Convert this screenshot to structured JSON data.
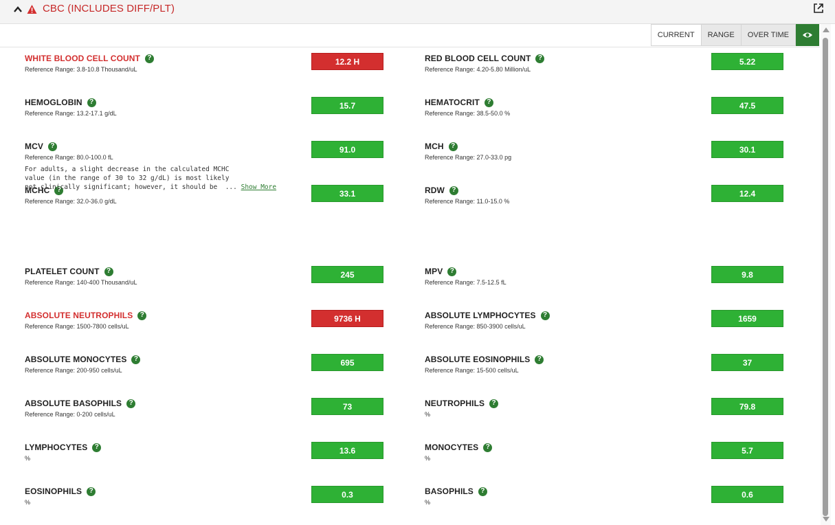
{
  "panel": {
    "title": "CBC (INCLUDES DIFF/PLT)",
    "colors": {
      "abnormal": "#d32f2f",
      "normal": "#2eb135",
      "accent": "#2e7d32"
    },
    "icons": {
      "collapse": "chevron-up-icon",
      "warning": "warning-icon",
      "external": "external-link-icon",
      "help": "help-icon",
      "view": "eye-icon"
    }
  },
  "toolbar": {
    "tab_current": "CURRENT",
    "tab_range": "RANGE",
    "tab_over_time": "OVER TIME"
  },
  "rows": [
    {
      "left": {
        "name": "WHITE BLOOD CELL COUNT",
        "ref": "Reference Range: 3.8-10.8 Thousand/uL",
        "value": "12.2 H",
        "abnormal": true
      },
      "right": {
        "name": "RED BLOOD CELL COUNT",
        "ref": "Reference Range: 4.20-5.80 Million/uL",
        "value": "5.22",
        "abnormal": false
      }
    },
    {
      "left": {
        "name": "HEMOGLOBIN",
        "ref": "Reference Range: 13.2-17.1 g/dL",
        "value": "15.7",
        "abnormal": false
      },
      "right": {
        "name": "HEMATOCRIT",
        "ref": "Reference Range: 38.5-50.0 %",
        "value": "47.5",
        "abnormal": false
      }
    },
    {
      "left": {
        "name": "MCV",
        "ref": "Reference Range: 80.0-100.0 fL",
        "value": "91.0",
        "abnormal": false
      },
      "right": {
        "name": "MCH",
        "ref": "Reference Range: 27.0-33.0 pg",
        "value": "30.1",
        "abnormal": false
      }
    },
    {
      "left": {
        "name": "MCHC",
        "ref": "Reference Range: 32.0-36.0 g/dL",
        "value": "33.1",
        "abnormal": false
      },
      "right": {
        "name": "RDW",
        "ref": "Reference Range: 11.0-15.0 %",
        "value": "12.4",
        "abnormal": false
      }
    },
    {
      "left": {
        "name": "PLATELET COUNT",
        "ref": "Reference Range: 140-400 Thousand/uL",
        "value": "245",
        "abnormal": false
      },
      "right": {
        "name": "MPV",
        "ref": "Reference Range: 7.5-12.5 fL",
        "value": "9.8",
        "abnormal": false
      }
    },
    {
      "left": {
        "name": "ABSOLUTE NEUTROPHILS",
        "ref": "Reference Range: 1500-7800 cells/uL",
        "value": "9736 H",
        "abnormal": true
      },
      "right": {
        "name": "ABSOLUTE LYMPHOCYTES",
        "ref": "Reference Range: 850-3900 cells/uL",
        "value": "1659",
        "abnormal": false
      }
    },
    {
      "left": {
        "name": "ABSOLUTE MONOCYTES",
        "ref": "Reference Range: 200-950 cells/uL",
        "value": "695",
        "abnormal": false
      },
      "right": {
        "name": "ABSOLUTE EOSINOPHILS",
        "ref": "Reference Range: 15-500 cells/uL",
        "value": "37",
        "abnormal": false
      }
    },
    {
      "left": {
        "name": "ABSOLUTE BASOPHILS",
        "ref": "Reference Range: 0-200 cells/uL",
        "value": "73",
        "abnormal": false
      },
      "right": {
        "name": "NEUTROPHILS",
        "ref": "%",
        "value": "79.8",
        "abnormal": false
      }
    },
    {
      "left": {
        "name": "LYMPHOCYTES",
        "ref": "%",
        "value": "13.6",
        "abnormal": false
      },
      "right": {
        "name": "MONOCYTES",
        "ref": "%",
        "value": "5.7",
        "abnormal": false
      }
    },
    {
      "left": {
        "name": "EOSINOPHILS",
        "ref": "%",
        "value": "0.3",
        "abnormal": false
      },
      "right": {
        "name": "BASOPHILS",
        "ref": "%",
        "value": "0.6",
        "abnormal": false
      }
    }
  ],
  "mchc_note": {
    "line1": "For adults, a slight decrease in the calculated MCHC",
    "line2": "value (in the range of 30 to 32 g/dL) is most likely",
    "line3": "not clinically significant; however, it should be  ...",
    "show_more": "Show More"
  }
}
